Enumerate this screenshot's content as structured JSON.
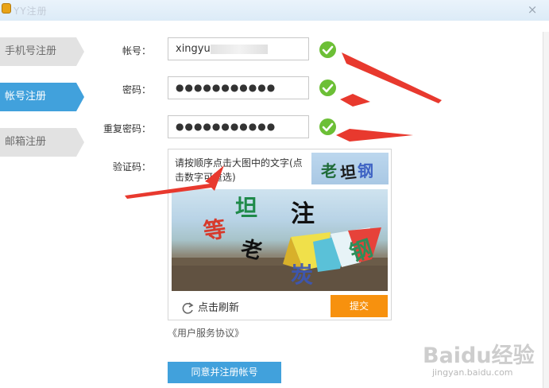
{
  "window": {
    "title": "YY注册",
    "close_label": "×"
  },
  "sidebar": {
    "tabs": [
      {
        "label": "手机号注册",
        "active": false
      },
      {
        "label": "帐号注册",
        "active": true
      },
      {
        "label": "邮箱注册",
        "active": false
      }
    ]
  },
  "form": {
    "account": {
      "label": "帐号：",
      "value": "xingyu"
    },
    "password": {
      "label": "密码：",
      "value": "●●●●●●●●●●●"
    },
    "confirm": {
      "label": "重复密码：",
      "value": "●●●●●●●●●●●"
    },
    "captcha_label": "验证码："
  },
  "captcha": {
    "instruction": "请按顺序点击大图中的文字(点击数字可重选)",
    "target_chars": [
      "老",
      "坦",
      "钢"
    ],
    "image_chars": [
      "等",
      "坦",
      "注",
      "老",
      "钢",
      "炭"
    ],
    "refresh_label": "点击刷新",
    "submit_label": "提交"
  },
  "agreement_label": "《用户服务协议》",
  "register_button_label": "同意并注册帐号",
  "watermark": {
    "text": "Baidu经验",
    "sub": "jingyan.baidu.com"
  },
  "colors": {
    "accent": "#41a1dc",
    "ok": "#6cbf36",
    "submit": "#f7910e",
    "arrow": "#e8392e"
  },
  "icons": [
    "check-circle-icon",
    "refresh-icon",
    "close-icon",
    "app-icon"
  ]
}
